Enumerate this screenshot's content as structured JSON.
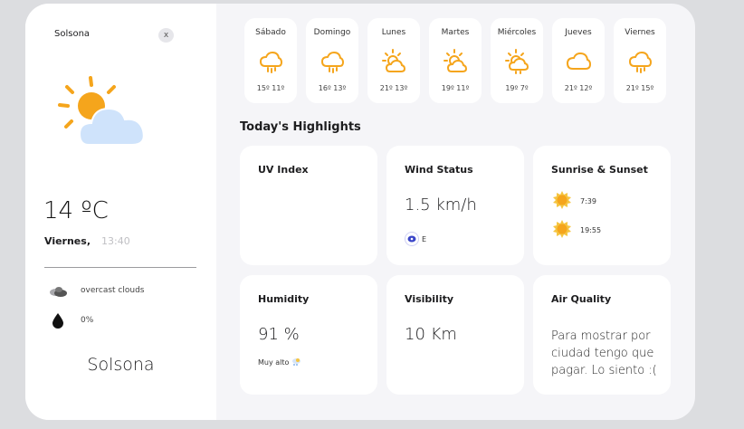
{
  "sidebar": {
    "city_label": "Solsona",
    "close_label": "x",
    "temperature": "14 ºC",
    "day": "Viernes,",
    "time": "13:40",
    "condition": "overcast clouds",
    "rain_chance": "0%",
    "city_name": "Solsona",
    "main_icon": "sun-behind-cloud-icon",
    "condition_icon": "clouds-icon",
    "rain_icon": "water-drop-icon"
  },
  "forecast": [
    {
      "day": "Sábado",
      "temps": "15º  11º",
      "icon": "rain-cloud-icon"
    },
    {
      "day": "Domingo",
      "temps": "16º  13º",
      "icon": "rain-cloud-icon"
    },
    {
      "day": "Lunes",
      "temps": "21º  13º",
      "icon": "sun-cloud-icon"
    },
    {
      "day": "Martes",
      "temps": "19º  11º",
      "icon": "sun-cloud-icon"
    },
    {
      "day": "Miércoles",
      "temps": "19º  7º",
      "icon": "sun-cloud-rain-icon"
    },
    {
      "day": "Jueves",
      "temps": "21º  12º",
      "icon": "cloud-icon"
    },
    {
      "day": "Viernes",
      "temps": "21º  15º",
      "icon": "rain-cloud-icon"
    }
  ],
  "highlights": {
    "title": "Today's Highlights",
    "uv": {
      "title": "UV Index"
    },
    "wind": {
      "title": "Wind Status",
      "value": "1.5 km/h",
      "direction": "E"
    },
    "sun": {
      "title": "Sunrise & Sunset",
      "sunrise": "7:39",
      "sunset": "19:55"
    },
    "humidity": {
      "title": "Humidity",
      "value": "91 %",
      "note": "Muy alto"
    },
    "visibility": {
      "title": "Visibility",
      "value": "10 Km"
    },
    "air": {
      "title": "Air Quality",
      "text": "Para mostrar por ciudad tengo que pagar. Lo siento :("
    }
  },
  "colors": {
    "accent": "#f5a51c",
    "cloud": "#cfe3fb",
    "card": "#ffffff",
    "panel": "#f5f5f8"
  }
}
